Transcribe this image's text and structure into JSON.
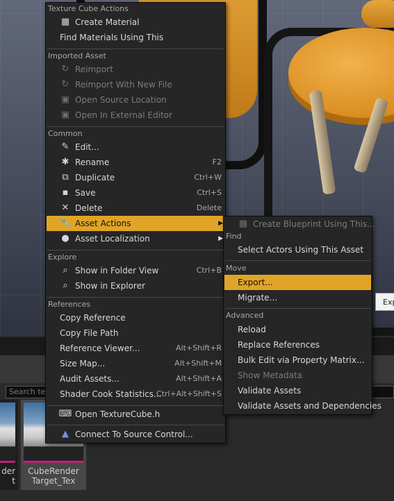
{
  "main_menu": {
    "sections": [
      {
        "header": "Texture Cube Actions",
        "items": [
          {
            "icon": "material-icon",
            "label": "Create Material",
            "shortcut": ""
          },
          {
            "icon": "",
            "label": "Find Materials Using This",
            "shortcut": ""
          }
        ]
      },
      {
        "header": "Imported Asset",
        "items": [
          {
            "icon": "reimport-icon",
            "label": "Reimport",
            "shortcut": "",
            "disabled": true
          },
          {
            "icon": "reimport-new-file-icon",
            "label": "Reimport With New File",
            "shortcut": "",
            "disabled": true
          },
          {
            "icon": "open-source-location-icon",
            "label": "Open Source Location",
            "shortcut": "",
            "disabled": true
          },
          {
            "icon": "external-editor-icon",
            "label": "Open In External Editor",
            "shortcut": "",
            "disabled": true
          }
        ]
      },
      {
        "header": "Common",
        "items": [
          {
            "icon": "edit-icon",
            "label": "Edit...",
            "shortcut": ""
          },
          {
            "icon": "rename-icon",
            "label": "Rename",
            "shortcut": "F2"
          },
          {
            "icon": "duplicate-icon",
            "label": "Duplicate",
            "shortcut": "Ctrl+W"
          },
          {
            "icon": "save-icon",
            "label": "Save",
            "shortcut": "Ctrl+S"
          },
          {
            "icon": "delete-icon",
            "label": "Delete",
            "shortcut": "Delete"
          },
          {
            "icon": "asset-actions-icon",
            "label": "Asset Actions",
            "shortcut": "",
            "submenu": true,
            "highlighted": true
          },
          {
            "icon": "asset-localization-icon",
            "label": "Asset Localization",
            "shortcut": "",
            "submenu": true
          }
        ]
      },
      {
        "header": "Explore",
        "items": [
          {
            "icon": "folder-view-icon",
            "label": "Show in Folder View",
            "shortcut": "Ctrl+B"
          },
          {
            "icon": "explorer-icon",
            "label": "Show in Explorer",
            "shortcut": ""
          }
        ]
      },
      {
        "header": "References",
        "items": [
          {
            "icon": "",
            "label": "Copy Reference",
            "shortcut": ""
          },
          {
            "icon": "",
            "label": "Copy File Path",
            "shortcut": ""
          },
          {
            "icon": "",
            "label": "Reference Viewer...",
            "shortcut": "Alt+Shift+R"
          },
          {
            "icon": "",
            "label": "Size Map...",
            "shortcut": "Alt+Shift+M"
          },
          {
            "icon": "",
            "label": "Audit Assets...",
            "shortcut": "Alt+Shift+A"
          },
          {
            "icon": "",
            "label": "Shader Cook Statistics...",
            "shortcut": "Ctrl+Alt+Shift+S"
          }
        ]
      }
    ],
    "extra_items": [
      {
        "icon": "open-header-icon",
        "label": "Open TextureCube.h"
      },
      {
        "icon": "source-control-icon",
        "label": "Connect To Source Control..."
      }
    ]
  },
  "sub_menu": {
    "top_item": {
      "icon": "blueprint-icon",
      "label": "Create Blueprint Using This...",
      "disabled": true
    },
    "sections": [
      {
        "header": "Find",
        "items": [
          {
            "label": "Select Actors Using This Asset"
          }
        ]
      },
      {
        "header": "Move",
        "items": [
          {
            "label": "Export...",
            "highlighted": true
          },
          {
            "label": "Migrate..."
          }
        ]
      },
      {
        "header": "Advanced",
        "items": [
          {
            "label": "Reload"
          },
          {
            "label": "Replace References"
          },
          {
            "label": "Bulk Edit via Property Matrix..."
          },
          {
            "label": "Show Metadata",
            "disabled": true
          },
          {
            "label": "Validate Assets"
          },
          {
            "label": "Validate Assets and Dependencies"
          }
        ]
      }
    ]
  },
  "tooltip": {
    "text": "Exp"
  },
  "content_browser": {
    "search_placeholder": "Search tex",
    "tiles": [
      {
        "label_line1": "der",
        "label_line2": "t"
      },
      {
        "label_line1": "CubeRender",
        "label_line2": "Target_Tex",
        "selected": true
      }
    ]
  },
  "colors": {
    "highlight": "#e0a526",
    "menu_bg": "#262626",
    "thumb_underline": "#c2207b"
  }
}
